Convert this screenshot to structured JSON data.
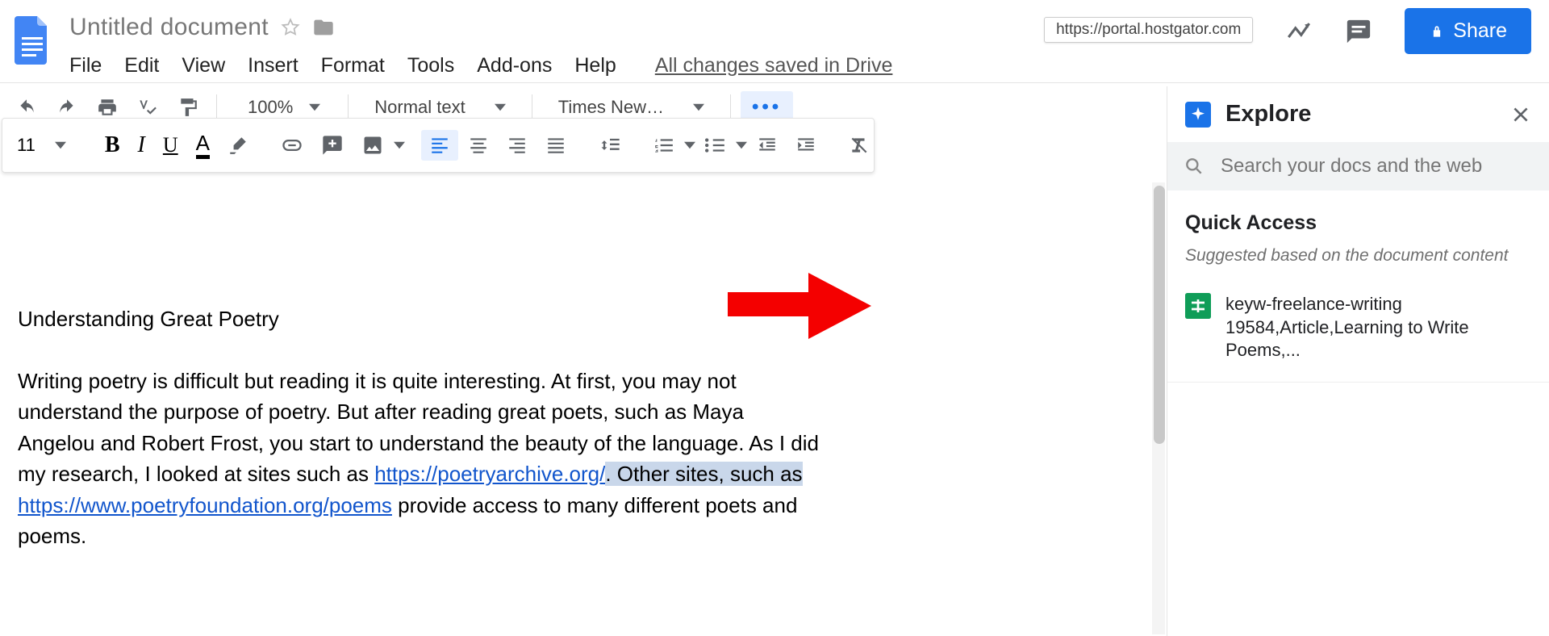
{
  "header": {
    "title": "Untitled document",
    "menus": [
      "File",
      "Edit",
      "View",
      "Insert",
      "Format",
      "Tools",
      "Add-ons",
      "Help"
    ],
    "save_status": "All changes saved in Drive",
    "url_tooltip": "https://portal.hostgator.com",
    "share_label": "Share"
  },
  "toolbar1": {
    "zoom": "100%",
    "paragraph_style": "Normal text",
    "font": "Times New…"
  },
  "toolbar2": {
    "font_size": "11"
  },
  "document": {
    "heading": "Understanding Great Poetry",
    "p1_a": "Writing poetry is difficult but reading it is quite interesting. At first, you may not understand the purpose of poetry. But after reading great poets, such as Maya Angelou and Robert Frost, you start to understand the beauty of the language. As I did my research, I looked at sites such as ",
    "link1": "https://poetryarchive.org/",
    "p1_b": ". Other sites, such as ",
    "link2": "https://www.poetryfoundation.org/poems",
    "p1_c": " provide access to many different poets and poems."
  },
  "explore": {
    "title": "Explore",
    "search_placeholder": "Search your docs and the web",
    "quick_access_title": "Quick Access",
    "quick_access_sub": "Suggested based on the document content",
    "item": {
      "name": "keyw-freelance-writing",
      "detail": "19584,Article,Learning to Write Poems,..."
    }
  }
}
